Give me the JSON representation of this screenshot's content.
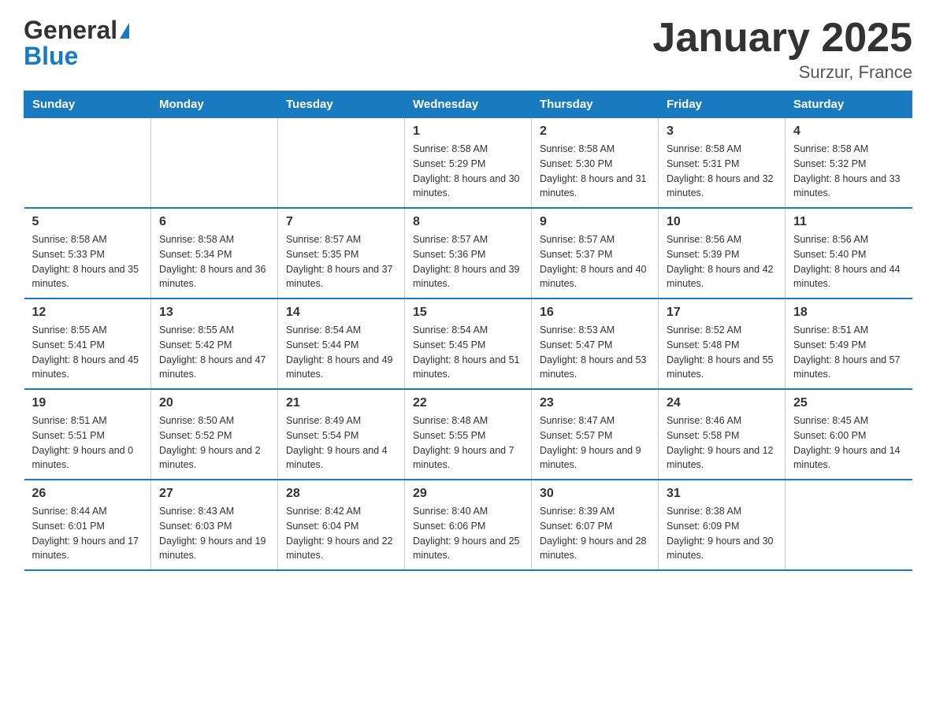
{
  "header": {
    "logo_general": "General",
    "logo_blue": "Blue",
    "month_title": "January 2025",
    "location": "Surzur, France"
  },
  "days_of_week": [
    "Sunday",
    "Monday",
    "Tuesday",
    "Wednesday",
    "Thursday",
    "Friday",
    "Saturday"
  ],
  "weeks": [
    [
      {
        "day": "",
        "sunrise": "",
        "sunset": "",
        "daylight": ""
      },
      {
        "day": "",
        "sunrise": "",
        "sunset": "",
        "daylight": ""
      },
      {
        "day": "",
        "sunrise": "",
        "sunset": "",
        "daylight": ""
      },
      {
        "day": "1",
        "sunrise": "Sunrise: 8:58 AM",
        "sunset": "Sunset: 5:29 PM",
        "daylight": "Daylight: 8 hours and 30 minutes."
      },
      {
        "day": "2",
        "sunrise": "Sunrise: 8:58 AM",
        "sunset": "Sunset: 5:30 PM",
        "daylight": "Daylight: 8 hours and 31 minutes."
      },
      {
        "day": "3",
        "sunrise": "Sunrise: 8:58 AM",
        "sunset": "Sunset: 5:31 PM",
        "daylight": "Daylight: 8 hours and 32 minutes."
      },
      {
        "day": "4",
        "sunrise": "Sunrise: 8:58 AM",
        "sunset": "Sunset: 5:32 PM",
        "daylight": "Daylight: 8 hours and 33 minutes."
      }
    ],
    [
      {
        "day": "5",
        "sunrise": "Sunrise: 8:58 AM",
        "sunset": "Sunset: 5:33 PM",
        "daylight": "Daylight: 8 hours and 35 minutes."
      },
      {
        "day": "6",
        "sunrise": "Sunrise: 8:58 AM",
        "sunset": "Sunset: 5:34 PM",
        "daylight": "Daylight: 8 hours and 36 minutes."
      },
      {
        "day": "7",
        "sunrise": "Sunrise: 8:57 AM",
        "sunset": "Sunset: 5:35 PM",
        "daylight": "Daylight: 8 hours and 37 minutes."
      },
      {
        "day": "8",
        "sunrise": "Sunrise: 8:57 AM",
        "sunset": "Sunset: 5:36 PM",
        "daylight": "Daylight: 8 hours and 39 minutes."
      },
      {
        "day": "9",
        "sunrise": "Sunrise: 8:57 AM",
        "sunset": "Sunset: 5:37 PM",
        "daylight": "Daylight: 8 hours and 40 minutes."
      },
      {
        "day": "10",
        "sunrise": "Sunrise: 8:56 AM",
        "sunset": "Sunset: 5:39 PM",
        "daylight": "Daylight: 8 hours and 42 minutes."
      },
      {
        "day": "11",
        "sunrise": "Sunrise: 8:56 AM",
        "sunset": "Sunset: 5:40 PM",
        "daylight": "Daylight: 8 hours and 44 minutes."
      }
    ],
    [
      {
        "day": "12",
        "sunrise": "Sunrise: 8:55 AM",
        "sunset": "Sunset: 5:41 PM",
        "daylight": "Daylight: 8 hours and 45 minutes."
      },
      {
        "day": "13",
        "sunrise": "Sunrise: 8:55 AM",
        "sunset": "Sunset: 5:42 PM",
        "daylight": "Daylight: 8 hours and 47 minutes."
      },
      {
        "day": "14",
        "sunrise": "Sunrise: 8:54 AM",
        "sunset": "Sunset: 5:44 PM",
        "daylight": "Daylight: 8 hours and 49 minutes."
      },
      {
        "day": "15",
        "sunrise": "Sunrise: 8:54 AM",
        "sunset": "Sunset: 5:45 PM",
        "daylight": "Daylight: 8 hours and 51 minutes."
      },
      {
        "day": "16",
        "sunrise": "Sunrise: 8:53 AM",
        "sunset": "Sunset: 5:47 PM",
        "daylight": "Daylight: 8 hours and 53 minutes."
      },
      {
        "day": "17",
        "sunrise": "Sunrise: 8:52 AM",
        "sunset": "Sunset: 5:48 PM",
        "daylight": "Daylight: 8 hours and 55 minutes."
      },
      {
        "day": "18",
        "sunrise": "Sunrise: 8:51 AM",
        "sunset": "Sunset: 5:49 PM",
        "daylight": "Daylight: 8 hours and 57 minutes."
      }
    ],
    [
      {
        "day": "19",
        "sunrise": "Sunrise: 8:51 AM",
        "sunset": "Sunset: 5:51 PM",
        "daylight": "Daylight: 9 hours and 0 minutes."
      },
      {
        "day": "20",
        "sunrise": "Sunrise: 8:50 AM",
        "sunset": "Sunset: 5:52 PM",
        "daylight": "Daylight: 9 hours and 2 minutes."
      },
      {
        "day": "21",
        "sunrise": "Sunrise: 8:49 AM",
        "sunset": "Sunset: 5:54 PM",
        "daylight": "Daylight: 9 hours and 4 minutes."
      },
      {
        "day": "22",
        "sunrise": "Sunrise: 8:48 AM",
        "sunset": "Sunset: 5:55 PM",
        "daylight": "Daylight: 9 hours and 7 minutes."
      },
      {
        "day": "23",
        "sunrise": "Sunrise: 8:47 AM",
        "sunset": "Sunset: 5:57 PM",
        "daylight": "Daylight: 9 hours and 9 minutes."
      },
      {
        "day": "24",
        "sunrise": "Sunrise: 8:46 AM",
        "sunset": "Sunset: 5:58 PM",
        "daylight": "Daylight: 9 hours and 12 minutes."
      },
      {
        "day": "25",
        "sunrise": "Sunrise: 8:45 AM",
        "sunset": "Sunset: 6:00 PM",
        "daylight": "Daylight: 9 hours and 14 minutes."
      }
    ],
    [
      {
        "day": "26",
        "sunrise": "Sunrise: 8:44 AM",
        "sunset": "Sunset: 6:01 PM",
        "daylight": "Daylight: 9 hours and 17 minutes."
      },
      {
        "day": "27",
        "sunrise": "Sunrise: 8:43 AM",
        "sunset": "Sunset: 6:03 PM",
        "daylight": "Daylight: 9 hours and 19 minutes."
      },
      {
        "day": "28",
        "sunrise": "Sunrise: 8:42 AM",
        "sunset": "Sunset: 6:04 PM",
        "daylight": "Daylight: 9 hours and 22 minutes."
      },
      {
        "day": "29",
        "sunrise": "Sunrise: 8:40 AM",
        "sunset": "Sunset: 6:06 PM",
        "daylight": "Daylight: 9 hours and 25 minutes."
      },
      {
        "day": "30",
        "sunrise": "Sunrise: 8:39 AM",
        "sunset": "Sunset: 6:07 PM",
        "daylight": "Daylight: 9 hours and 28 minutes."
      },
      {
        "day": "31",
        "sunrise": "Sunrise: 8:38 AM",
        "sunset": "Sunset: 6:09 PM",
        "daylight": "Daylight: 9 hours and 30 minutes."
      },
      {
        "day": "",
        "sunrise": "",
        "sunset": "",
        "daylight": ""
      }
    ]
  ]
}
